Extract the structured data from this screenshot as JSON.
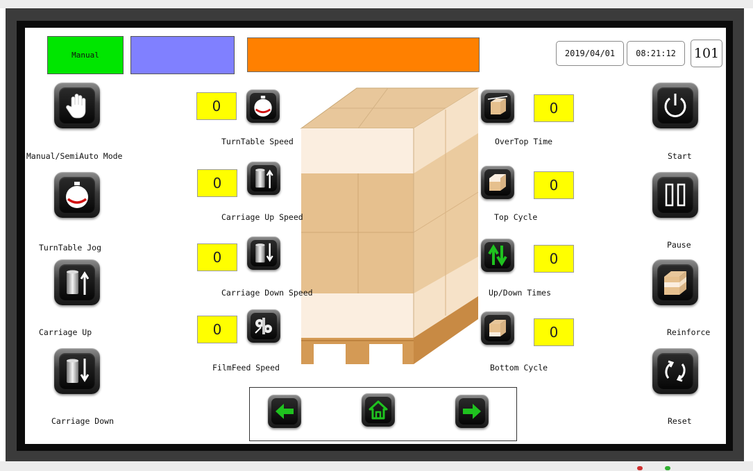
{
  "header": {
    "mode_status": "Manual",
    "date": "2019/04/01",
    "time": "08:21:12",
    "screen_number": "101"
  },
  "left_buttons": [
    {
      "label": "Manual/SemiAuto Mode",
      "icon": "hand-icon"
    },
    {
      "label": "TurnTable Jog",
      "icon": "turntable-icon"
    },
    {
      "label": "Carriage Up",
      "icon": "carriage-up-icon"
    },
    {
      "label": "Carriage Down",
      "icon": "carriage-down-icon"
    }
  ],
  "left_params": [
    {
      "label": "TurnTable Speed",
      "value": "0",
      "icon": "turntable-icon"
    },
    {
      "label": "Carriage Up Speed",
      "value": "0",
      "icon": "carriage-up-icon"
    },
    {
      "label": "Carriage Down Speed",
      "value": "0",
      "icon": "carriage-down-icon"
    },
    {
      "label": "FilmFeed Speed",
      "value": "0",
      "icon": "film-feed-icon"
    }
  ],
  "right_params": [
    {
      "label": "OverTop Time",
      "value": "0",
      "icon": "over-top-icon"
    },
    {
      "label": "Top Cycle",
      "value": "0",
      "icon": "top-cycle-icon"
    },
    {
      "label": "Up/Down Times",
      "value": "0",
      "icon": "up-down-arrows-icon"
    },
    {
      "label": "Bottom Cycle",
      "value": "0",
      "icon": "bottom-cycle-icon"
    }
  ],
  "right_buttons": [
    {
      "label": "Start",
      "icon": "power-icon"
    },
    {
      "label": "Pause",
      "icon": "pause-icon"
    },
    {
      "label": "Reinforce",
      "icon": "reinforce-icon"
    },
    {
      "label": "Reset",
      "icon": "reset-icon"
    }
  ],
  "nav": {
    "prev_icon": "arrow-left-icon",
    "home_icon": "home-icon",
    "next_icon": "arrow-right-icon"
  },
  "colors": {
    "mode_box": "#00e600",
    "status_box": "#8080ff",
    "alarm_bar": "#ff8000",
    "value_box": "#ffff00",
    "nav_green": "#1fc21f"
  }
}
